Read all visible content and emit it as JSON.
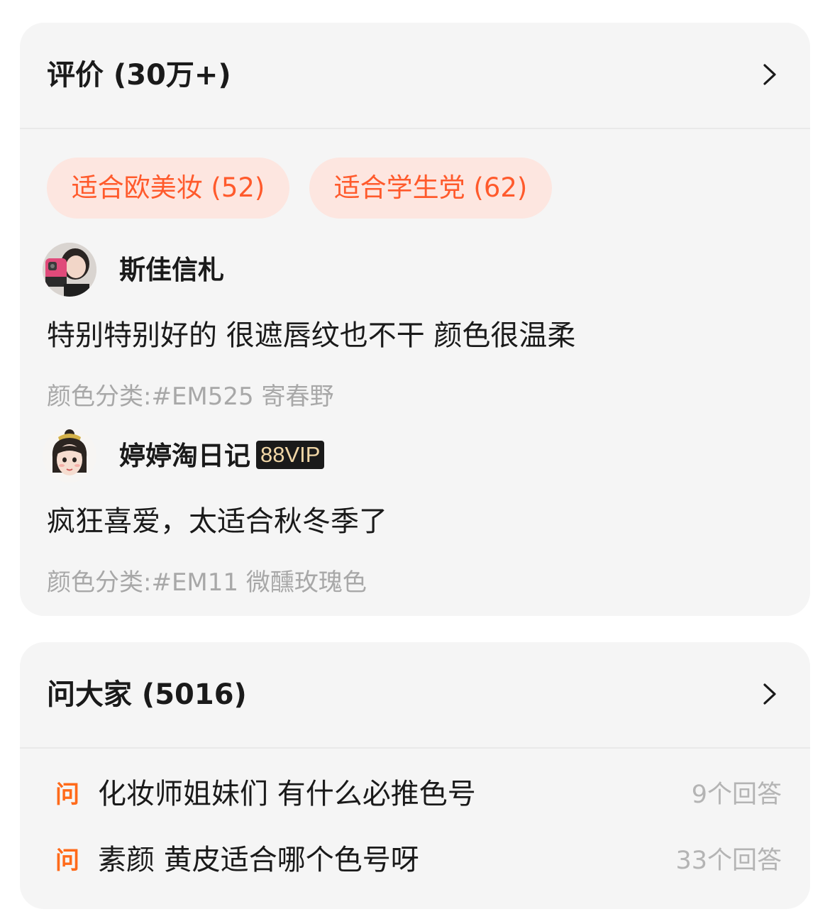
{
  "reviews": {
    "title": "评价 (30万+)",
    "tags": [
      {
        "label": "适合欧美妆 (52)"
      },
      {
        "label": "适合学生党 (62)"
      }
    ],
    "items": [
      {
        "username": "斯佳信札",
        "badge": "",
        "text": "特别特别好的 很遮唇纹也不干 颜色很温柔",
        "meta": "颜色分类:#EM525 寄春野"
      },
      {
        "username": "婷婷淘日记",
        "badge": "88VIP",
        "text": "疯狂喜爱，太适合秋冬季了",
        "meta": "颜色分类:#EM11 微醺玫瑰色"
      }
    ]
  },
  "qa": {
    "title": "问大家 (5016)",
    "badge_label": "问",
    "items": [
      {
        "question": "化妆师姐妹们 有什么必推色号",
        "answers": "9个回答"
      },
      {
        "question": "素颜 黄皮适合哪个色号呀",
        "answers": "33个回答"
      }
    ]
  },
  "colors": {
    "accent": "#ff5a2c",
    "tag_background": "#fde6e0",
    "qa_badge": "#ff6a1a",
    "card_background": "#f5f5f5",
    "muted_text": "#a8a8a8"
  },
  "icons": {
    "header_arrow": "chevron-right-icon"
  }
}
